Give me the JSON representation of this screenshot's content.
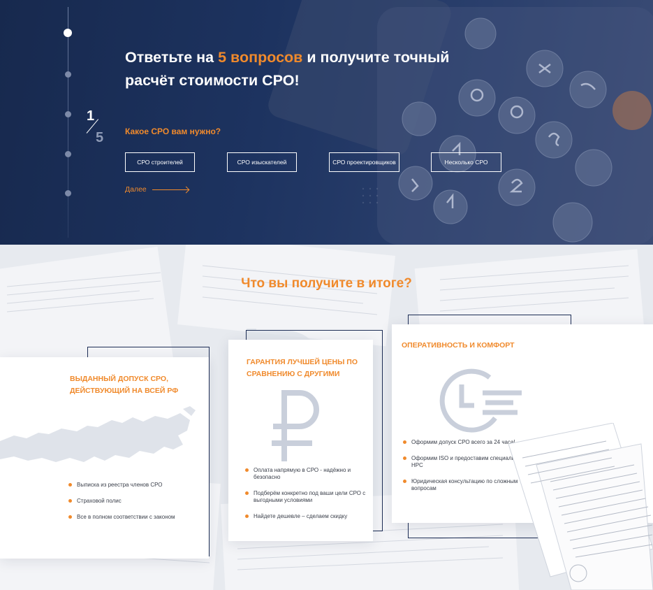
{
  "hero": {
    "title_part1": "Ответьте на ",
    "title_accent": "5 вопросов",
    "title_part2": " и получите точный расчёт стоимости СРО!",
    "step_current": "1",
    "step_total": "5",
    "question": "Какое СРО вам нужно?",
    "options": [
      "СРО строителей",
      "СРО изыскателей",
      "СРО проектировщиков",
      "Несколько СРО"
    ],
    "next_label": "Далее"
  },
  "results": {
    "title": "Что вы получите в итоге?",
    "cards": [
      {
        "title": "Выданный допуск СРО, действующий на всей РФ",
        "items": [
          "Выписка из реестра членов СРО",
          "Страховой полис",
          "Все в полном соответствии с законом"
        ],
        "icon": "russia-map-icon"
      },
      {
        "title": "Гарантия лучшей цены по сравнению с другими",
        "items": [
          "Оплата напрямую в СРО - надёжно и безопасно",
          "Подберём конкретно под ваши цели СРО с выгодными условиями",
          "Найдете дешевле – сделаем скидку"
        ],
        "icon": "ruble-icon"
      },
      {
        "title": "Оперативность и комфорт",
        "items": [
          "Оформим допуск СРО всего за 24 часа!",
          "Оформим ISO и предоставим специалистов НРС",
          "Юридическая консультацию по сложным вопросам"
        ],
        "icon": "clock-icon"
      }
    ]
  },
  "colors": {
    "accent": "#f08a2c",
    "navy": "#1d3360",
    "frame": "#1d2d55"
  }
}
